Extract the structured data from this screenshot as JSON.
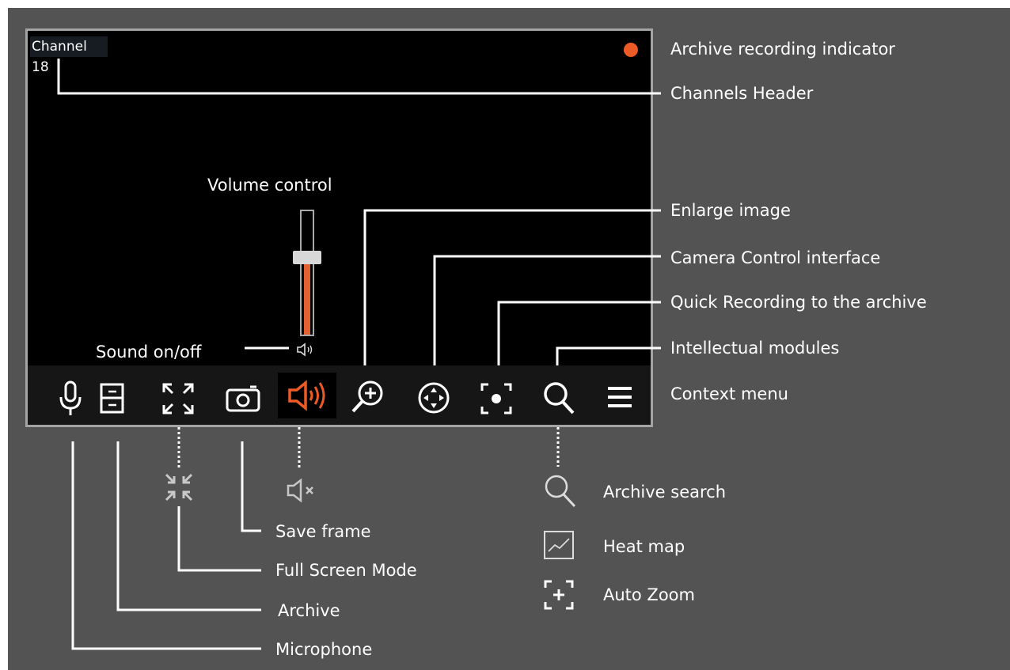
{
  "channel_header": "Channel 18",
  "colors": {
    "background": "#535353",
    "accent": "#ec5a26",
    "frame_border": "#a4a4a4"
  },
  "labels": {
    "archive_recording_indicator": "Archive recording indicator",
    "channels_header": "Channels Header",
    "volume_control": "Volume control",
    "sound_onoff": "Sound on/off",
    "enlarge_image": "Enlarge image",
    "camera_control_interface": "Camera Control interface",
    "quick_recording": "Quick Recording to the archive",
    "intellectual_modules": "Intellectual modules",
    "context_menu": "Context menu",
    "save_frame": "Save frame",
    "full_screen_mode": "Full Screen Mode",
    "archive": "Archive",
    "microphone": "Microphone",
    "archive_search": "Archive search",
    "heat_map": "Heat map",
    "auto_zoom": "Auto Zoom"
  },
  "volume_level": 0.62,
  "toolbar_icons": [
    "microphone-icon",
    "archive-icon",
    "fullscreen-icon",
    "camera-icon",
    "sound-icon",
    "zoom-in-icon",
    "ptz-icon",
    "quick-record-icon",
    "search-icon",
    "menu-icon"
  ]
}
